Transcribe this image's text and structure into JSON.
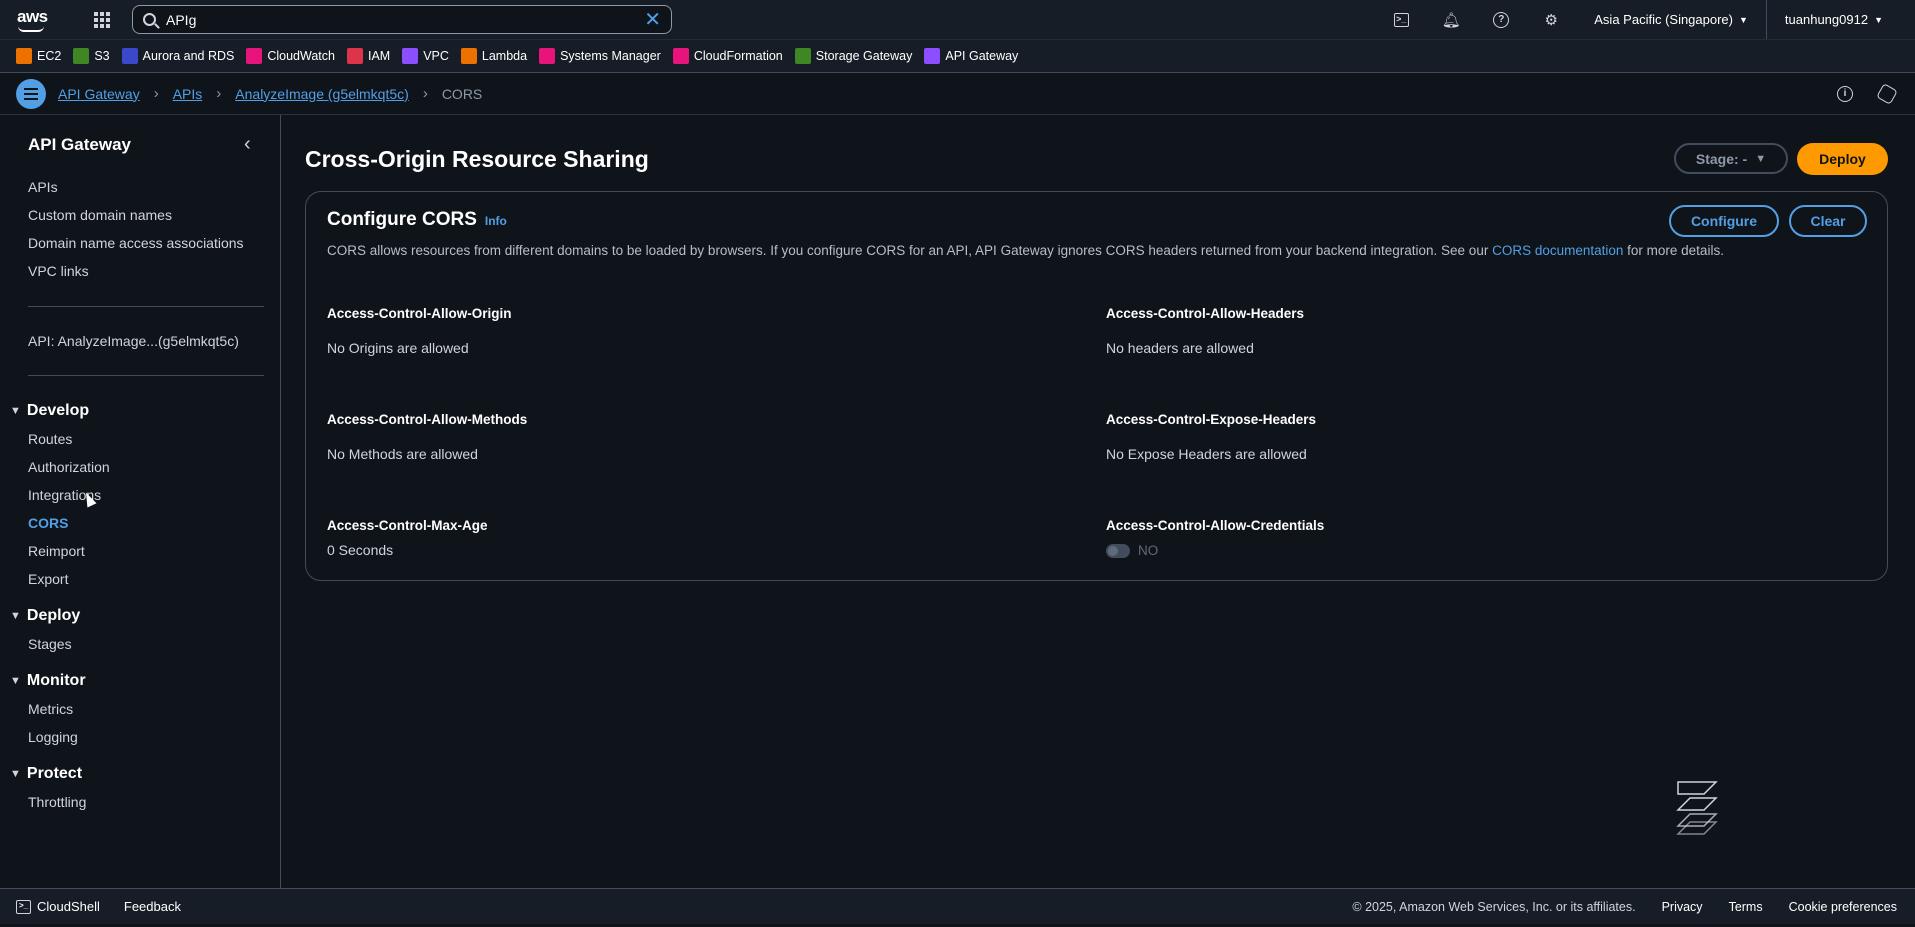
{
  "topnav": {
    "logo_text": "aws",
    "search_value": "APIg",
    "region": "Asia Pacific (Singapore)",
    "user": "tuanhung0912"
  },
  "favorites": [
    {
      "label": "EC2",
      "color": "#ed7100"
    },
    {
      "label": "S3",
      "color": "#3f8624"
    },
    {
      "label": "Aurora and RDS",
      "color": "#3b48cc"
    },
    {
      "label": "CloudWatch",
      "color": "#e7157b"
    },
    {
      "label": "IAM",
      "color": "#dd344c"
    },
    {
      "label": "VPC",
      "color": "#8c4fff"
    },
    {
      "label": "Lambda",
      "color": "#ed7100"
    },
    {
      "label": "Systems Manager",
      "color": "#e7157b"
    },
    {
      "label": "CloudFormation",
      "color": "#e7157b"
    },
    {
      "label": "Storage Gateway",
      "color": "#3f8624"
    },
    {
      "label": "API Gateway",
      "color": "#8c4fff"
    }
  ],
  "breadcrumb": {
    "items": [
      "API Gateway",
      "APIs",
      "AnalyzeImage (g5elmkqt5c)"
    ],
    "current": "CORS"
  },
  "sidebar": {
    "title": "API Gateway",
    "top_links": [
      "APIs",
      "Custom domain names",
      "Domain name access associations",
      "VPC links"
    ],
    "api_link": "API: AnalyzeImage...(g5elmkqt5c)",
    "sections": {
      "develop": {
        "title": "Develop",
        "items": [
          "Routes",
          "Authorization",
          "Integrations",
          "CORS",
          "Reimport",
          "Export"
        ]
      },
      "deploy": {
        "title": "Deploy",
        "items": [
          "Stages"
        ]
      },
      "monitor": {
        "title": "Monitor",
        "items": [
          "Metrics",
          "Logging"
        ]
      },
      "protect": {
        "title": "Protect",
        "items": [
          "Throttling"
        ]
      }
    }
  },
  "main": {
    "title": "Cross-Origin Resource Sharing",
    "stage_label": "Stage: -",
    "deploy_label": "Deploy",
    "card": {
      "title": "Configure CORS",
      "info": "Info",
      "desc_before": "CORS allows resources from different domains to be loaded by browsers. If you configure CORS for an API, API Gateway ignores CORS headers returned from your backend integration. See our ",
      "desc_link": "CORS documentation",
      "desc_after": " for more details.",
      "configure_label": "Configure",
      "clear_label": "Clear",
      "fields": {
        "allow_origin": {
          "label": "Access-Control-Allow-Origin",
          "value": "No Origins are allowed"
        },
        "allow_headers": {
          "label": "Access-Control-Allow-Headers",
          "value": "No headers are allowed"
        },
        "allow_methods": {
          "label": "Access-Control-Allow-Methods",
          "value": "No Methods are allowed"
        },
        "expose_headers": {
          "label": "Access-Control-Expose-Headers",
          "value": "No Expose Headers are allowed"
        },
        "max_age": {
          "label": "Access-Control-Max-Age",
          "value": "0 Seconds"
        },
        "allow_credentials": {
          "label": "Access-Control-Allow-Credentials",
          "value": "NO"
        }
      }
    }
  },
  "footer": {
    "cloudshell": "CloudShell",
    "feedback": "Feedback",
    "copyright": "© 2025, Amazon Web Services, Inc. or its affiliates.",
    "privacy": "Privacy",
    "terms": "Terms",
    "cookies": "Cookie preferences"
  }
}
